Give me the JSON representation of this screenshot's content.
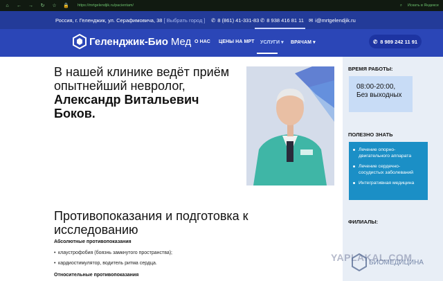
{
  "browser": {
    "url": "https://mrtgelendjik.ru/pacientam/",
    "right_label": "Искать в Яндексе"
  },
  "topbar": {
    "address": "Россия, г. Геленджик, ул. Серафимовича, 38",
    "city_select": "[ Выбрать город ]",
    "phone1": "8 (861) 41-331-83",
    "phone2": "8 938 416 81 11",
    "email": "i@mrtgelendjik.ru"
  },
  "nav": {
    "logo_main": "Геленджик-Био",
    "logo_accent": "Мед",
    "items": [
      {
        "label": "О нас"
      },
      {
        "label": "Цены на МРТ"
      },
      {
        "label": "Услуги"
      },
      {
        "label": "Врачам"
      }
    ],
    "call_phone": "8 989 242 11 91"
  },
  "main": {
    "headline_line1": "В нашей клинике ведёт приём",
    "headline_line2": "опытнейший невролог,",
    "headline_bold": "Александр Витальевич Боков.",
    "section_title": "Противопоказания и подготовка к исследованию",
    "absolute_title": "Абсолютные противопоказания",
    "absolute_items": [
      "клаустрофобия (боязнь замкнутого пространства);",
      "кардиостимулятор, водитель ритма сердца."
    ],
    "relative_title": "Относительные противопоказания"
  },
  "sidebar": {
    "hours_title": "ВРЕМЯ РАБОТЫ:",
    "hours_line1": "08:00-20:00,",
    "hours_line2": "Без выходных",
    "useful_title": "ПОЛЕЗНО ЗНАТЬ",
    "useful_items": [
      "Лечение опорно-двигательного аппарата",
      "Лечение сердечно-сосудистых заболеваний",
      "Интегративная медицина"
    ],
    "branches_title": "ФИЛИАЛЫ:"
  },
  "watermark": {
    "text": "YAPLAKAL.COM",
    "logo_text": "БИОМЕДИЦИНА"
  },
  "colors": {
    "topbar": "#233b99",
    "nav": "#2b46b7",
    "sidebar": "#e8eef6",
    "useful_box": "#1b8fc6",
    "hours_box": "#c8dcf6"
  }
}
